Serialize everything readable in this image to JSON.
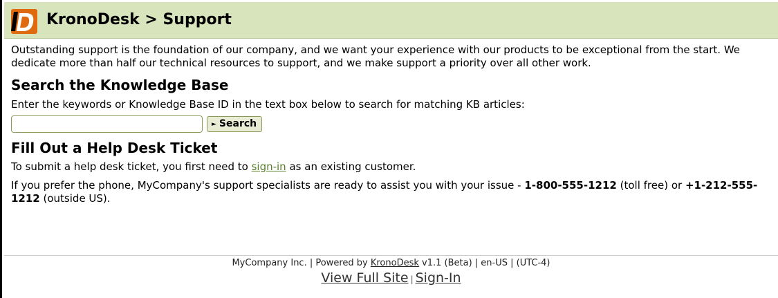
{
  "header": {
    "title": "KronoDesk > Support",
    "logo_icon": "kronodesk-logo-icon",
    "logo_colors": {
      "background": "#e06a10",
      "letter": "#ffffff",
      "stripe": "#000000"
    },
    "background_color": "#d8e4bc"
  },
  "intro": {
    "text": "Outstanding support is the foundation of our company, and we want your experience with our products to be exceptional from the start. We dedicate more than half our technical resources to support, and we make support a priority over all other work."
  },
  "knowledge_base": {
    "heading": "Search the Knowledge Base",
    "instructions": "Enter the keywords or Knowledge Base ID in the text box below to search for matching KB articles:",
    "search_value": "",
    "search_button_label": "Search",
    "search_button_icon": "triangle-right-icon"
  },
  "ticket": {
    "heading": "Fill Out a Help Desk Ticket",
    "line_before": "To submit a help desk ticket, you first need to ",
    "signin_link": "sign-in",
    "line_after": " as an existing customer.",
    "phone_text_1": "If you prefer the phone, MyCompany's support specialists are ready to assist you with your issue - ",
    "phone_toll_free": "1-800-555-1212",
    "phone_text_2": " (toll free) or ",
    "phone_outside": "+1-212-555-1212",
    "phone_text_3": " (outside US).",
    "link_color": "#5a7d2a"
  },
  "footer": {
    "text_before": "MyCompany Inc. | Powered by ",
    "powered_link": "KronoDesk",
    "text_after": " v1.1 (Beta) | en-US | (UTC-4)",
    "view_full_site": "View Full Site",
    "separator": "|",
    "signin": "Sign-In"
  }
}
